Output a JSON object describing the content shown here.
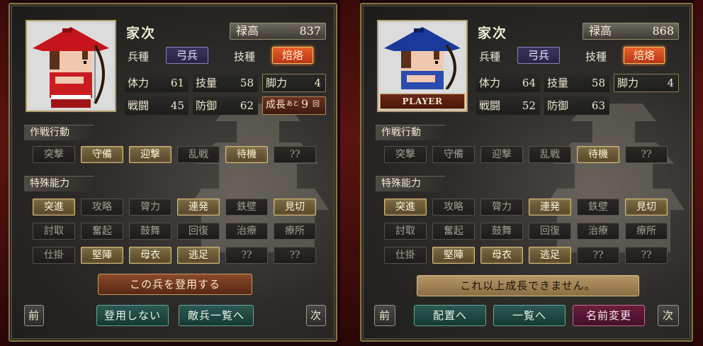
{
  "left": {
    "portrait_variant": "red-hat-archer",
    "name": "家次",
    "kokudaka_label": "禄高",
    "kokudaka_value": "837",
    "troop_type_label": "兵種",
    "troop_type_value": "弓兵",
    "skill_label": "技種",
    "skill_value": "焙烙",
    "stats": [
      {
        "label": "体力",
        "value": "61"
      },
      {
        "label": "技量",
        "value": "58"
      },
      {
        "label": "脚力",
        "value": "4"
      },
      {
        "label": "戦闘",
        "value": "45"
      },
      {
        "label": "防御",
        "value": "62"
      }
    ],
    "growth_label": "成長",
    "growth_mid": "あと",
    "growth_value": "9",
    "growth_unit": "回",
    "tactics_title": "作戦行動",
    "tactics": [
      {
        "label": "突撃",
        "active": false
      },
      {
        "label": "守備",
        "active": true
      },
      {
        "label": "迎撃",
        "active": true
      },
      {
        "label": "乱戦",
        "active": false
      },
      {
        "label": "待機",
        "active": true
      },
      {
        "label": "??",
        "active": false
      }
    ],
    "abilities_title": "特殊能力",
    "abilities": [
      {
        "label": "突進",
        "active": true
      },
      {
        "label": "攻略",
        "active": false
      },
      {
        "label": "膂力",
        "active": false
      },
      {
        "label": "連発",
        "active": true
      },
      {
        "label": "鉄壁",
        "active": false
      },
      {
        "label": "見切",
        "active": true
      },
      {
        "label": "討取",
        "active": false
      },
      {
        "label": "奮起",
        "active": false
      },
      {
        "label": "鼓舞",
        "active": false
      },
      {
        "label": "回復",
        "active": false
      },
      {
        "label": "治療",
        "active": false
      },
      {
        "label": "療所",
        "active": false
      },
      {
        "label": "仕掛",
        "active": false
      },
      {
        "label": "堅陣",
        "active": true
      },
      {
        "label": "母衣",
        "active": true
      },
      {
        "label": "逃足",
        "active": true
      },
      {
        "label": "??",
        "active": false
      },
      {
        "label": "??",
        "active": false
      }
    ],
    "main_button": "この兵を登用する",
    "prev_button": "前",
    "next_button": "次",
    "bottom_buttons": [
      "登用しない",
      "敵兵一覧へ"
    ]
  },
  "right": {
    "portrait_variant": "blue-hat-archer",
    "player_tag": "PLAYER",
    "name": "家次",
    "kokudaka_label": "禄高",
    "kokudaka_value": "868",
    "troop_type_label": "兵種",
    "troop_type_value": "弓兵",
    "skill_label": "技種",
    "skill_value": "焙烙",
    "stats": [
      {
        "label": "体力",
        "value": "64"
      },
      {
        "label": "技量",
        "value": "58"
      },
      {
        "label": "脚力",
        "value": "4"
      },
      {
        "label": "戦闘",
        "value": "52"
      },
      {
        "label": "防御",
        "value": "63"
      }
    ],
    "tactics_title": "作戦行動",
    "tactics": [
      {
        "label": "突撃",
        "active": false
      },
      {
        "label": "守備",
        "active": false
      },
      {
        "label": "迎撃",
        "active": false
      },
      {
        "label": "乱戦",
        "active": false
      },
      {
        "label": "待機",
        "active": true
      },
      {
        "label": "??",
        "active": false
      }
    ],
    "abilities_title": "特殊能力",
    "abilities": [
      {
        "label": "突進",
        "active": true
      },
      {
        "label": "攻略",
        "active": false
      },
      {
        "label": "膂力",
        "active": false
      },
      {
        "label": "連発",
        "active": true
      },
      {
        "label": "鉄壁",
        "active": false
      },
      {
        "label": "見切",
        "active": true
      },
      {
        "label": "討取",
        "active": false
      },
      {
        "label": "奮起",
        "active": false
      },
      {
        "label": "鼓舞",
        "active": false
      },
      {
        "label": "回復",
        "active": false
      },
      {
        "label": "治療",
        "active": false
      },
      {
        "label": "療所",
        "active": false
      },
      {
        "label": "仕掛",
        "active": false
      },
      {
        "label": "堅陣",
        "active": true
      },
      {
        "label": "母衣",
        "active": true
      },
      {
        "label": "逃足",
        "active": true
      },
      {
        "label": "??",
        "active": false
      },
      {
        "label": "??",
        "active": false
      }
    ],
    "main_button": "これ以上成長できません。",
    "prev_button": "前",
    "next_button": "次",
    "bottom_buttons": [
      "配置へ",
      "一覧へ",
      "名前変更"
    ]
  },
  "colors": {
    "panel_border": "#8a7445",
    "chip_active": "#7b6a44",
    "skill_highlight": "#e8622a",
    "troop_type_tag": "#3c3460",
    "recruit_button": "#8a4a2a",
    "teal_button": "#2a5a52",
    "magenta_button": "#6a1e3c"
  }
}
